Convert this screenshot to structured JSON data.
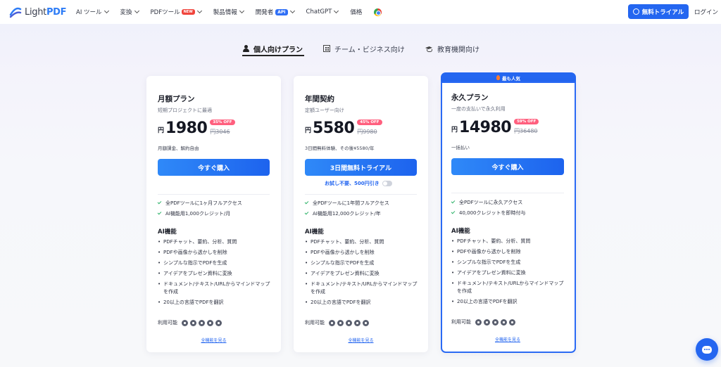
{
  "header": {
    "logo_text_a": "Light",
    "logo_text_b": "PDF",
    "nav": [
      {
        "label": "AI ツール",
        "has_chevron": true
      },
      {
        "label": "変換",
        "has_chevron": true
      },
      {
        "label": "PDFツール",
        "badge": "NEW",
        "has_chevron": true
      },
      {
        "label": "製品情報",
        "has_chevron": true
      },
      {
        "label": "開発者",
        "badge": "API",
        "has_chevron": true
      },
      {
        "label": "ChatGPT",
        "has_chevron": true
      },
      {
        "label": "価格",
        "has_chevron": false
      }
    ],
    "chrome_icon": "chrome-icon",
    "trial_button": "無料トライアル",
    "login": "ログイン"
  },
  "tabs": [
    {
      "label": "個人向けプラン",
      "icon": "person-icon",
      "active": true
    },
    {
      "label": "チーム・ビジネス向け",
      "icon": "building-icon",
      "active": false
    },
    {
      "label": "教育機関向け",
      "icon": "graduation-cap-icon",
      "active": false
    }
  ],
  "plans": [
    {
      "name": "月額プラン",
      "subtitle": "短期プロジェクトに最適",
      "currency": "円",
      "price": "1980",
      "discount": "35% OFF",
      "old_price": "円3046",
      "billing": "月額課金、解約自由",
      "button": "今すぐ購入",
      "checks": [
        "全PDFツールに1ヶ月フルアクセス",
        "AI機能用1,000クレジット/月"
      ],
      "ai_heading": "AI機能",
      "features": [
        "PDFチャット、要約、分析、質問",
        "PDFや画像から透かしを削除",
        "シンプルな指示でPDFを生成",
        "アイデアをプレゼン資料に変換",
        "ドキュメント/テキスト/URLからマインドマップを作成",
        "20以上の言語でPDFを翻訳"
      ],
      "available": "利用可能",
      "see_all": "全機能を見る"
    },
    {
      "name": "年間契約",
      "subtitle": "定額ユーザー向け",
      "currency": "円",
      "price": "5580",
      "discount": "45% OFF",
      "old_price": "円9980",
      "billing": "3日間無料体験、その後¥5580/年",
      "button": "3日間無料トライアル",
      "trial_note": "お試し不要、500円引き",
      "checks": [
        "全PDFツールに1年間フルアクセス",
        "AI機能用12,000クレジット/年"
      ],
      "ai_heading": "AI機能",
      "features": [
        "PDFチャット、要約、分析、質問",
        "PDFや画像から透かしを削除",
        "シンプルな指示でPDFを生成",
        "アイデアをプレゼン資料に変換",
        "ドキュメント/テキスト/URLからマインドマップを作成",
        "20以上の言語でPDFを翻訳"
      ],
      "available": "利用可能",
      "see_all": "全機能を見る"
    },
    {
      "name": "永久プラン",
      "badge": "最も人気",
      "subtitle": "一度の支払いで永久利用",
      "currency": "円",
      "price": "14980",
      "discount": "59% OFF",
      "old_price": "円36480",
      "billing": "一括払い",
      "button": "今すぐ購入",
      "checks": [
        "全PDFツールに永久アクセス",
        "40,000クレジットを即時付与"
      ],
      "ai_heading": "AI機能",
      "features": [
        "PDFチャット、要約、分析、質問",
        "PDFや画像から透かしを削除",
        "シンプルな指示でPDFを生成",
        "アイデアをプレゼン資料に変換",
        "ドキュメント/テキスト/URLからマインドマップを作成",
        "20以上の言語でPDFを翻訳"
      ],
      "available": "利用可能",
      "see_all": "全機能を見る"
    }
  ],
  "platform_icons": [
    "windows-icon",
    "mac-icon",
    "android-icon",
    "ios-icon",
    "web-icon"
  ],
  "colors": {
    "accent": "#2466f0",
    "discount": "#ff5f7e",
    "check": "#2fb36a"
  },
  "chat_icon": "chat-bubble-icon"
}
